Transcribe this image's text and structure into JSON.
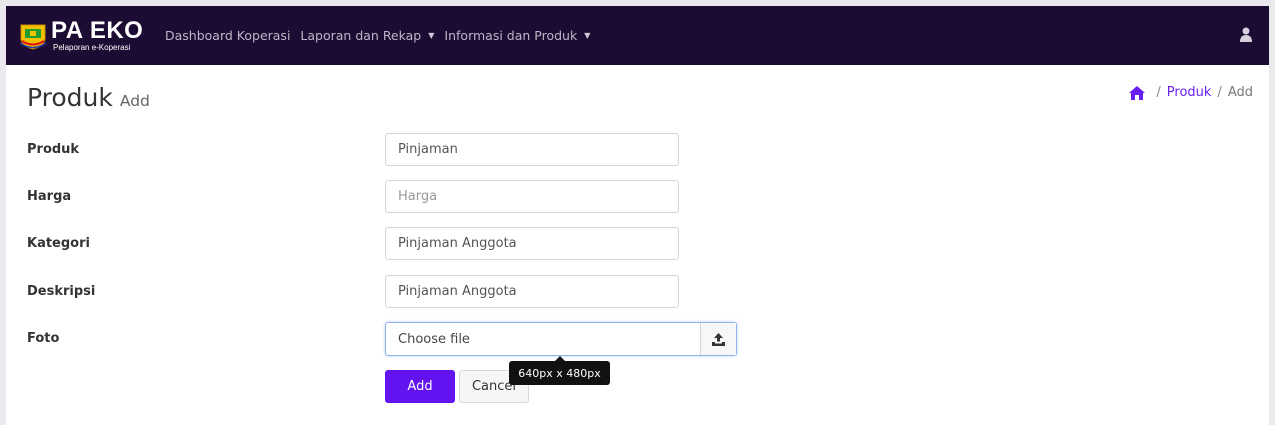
{
  "navbar": {
    "brand_title": "PA EKO",
    "brand_subtitle": "Pelaporan e-Koperasi",
    "items": [
      {
        "label": "Dashboard Koperasi"
      },
      {
        "label": "Laporan dan Rekap"
      },
      {
        "label": "Informasi dan Produk"
      }
    ],
    "caret": "▼"
  },
  "header": {
    "title": "Produk",
    "subtitle": "Add",
    "breadcrumb": {
      "link": "Produk",
      "current": "Add",
      "separator": "/"
    }
  },
  "form": {
    "produk": {
      "label": "Produk",
      "value": "Pinjaman"
    },
    "harga": {
      "label": "Harga",
      "value": "",
      "placeholder": "Harga"
    },
    "kategori": {
      "label": "Kategori",
      "value": "Pinjaman Anggota"
    },
    "deskripsi": {
      "label": "Deskripsi",
      "value": "Pinjaman Anggota"
    },
    "foto": {
      "label": "Foto",
      "file_text": "Choose file",
      "tooltip": "640px x 480px"
    },
    "add_label": "Add",
    "cancel_label": "Cancel"
  },
  "colors": {
    "navbar_bg": "#1c0b32",
    "accent": "#6213ef",
    "link": "#6a1df0"
  },
  "icons": {
    "home": "home-icon",
    "user": "user-icon",
    "upload": "upload-icon"
  }
}
